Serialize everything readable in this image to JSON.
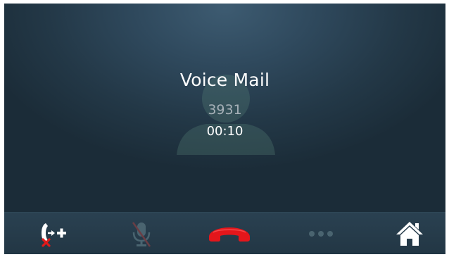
{
  "call": {
    "name": "Voice Mail",
    "number": "3931",
    "duration": "00:10"
  },
  "toolbar": {
    "buttons": [
      {
        "id": "transfer",
        "icon": "call-transfer-icon",
        "enabled": true
      },
      {
        "id": "mute",
        "icon": "microphone-muted-icon",
        "enabled": false
      },
      {
        "id": "end-call",
        "icon": "hang-up-icon",
        "enabled": true
      },
      {
        "id": "more",
        "icon": "more-dots-icon",
        "enabled": false
      },
      {
        "id": "home",
        "icon": "home-icon",
        "enabled": true
      }
    ]
  },
  "colors": {
    "background": "#2f495d",
    "hangup": "#e4161b",
    "cancel_mark": "#e01a1a",
    "text_primary": "#ffffff",
    "text_secondary": "#a7b1b8"
  }
}
